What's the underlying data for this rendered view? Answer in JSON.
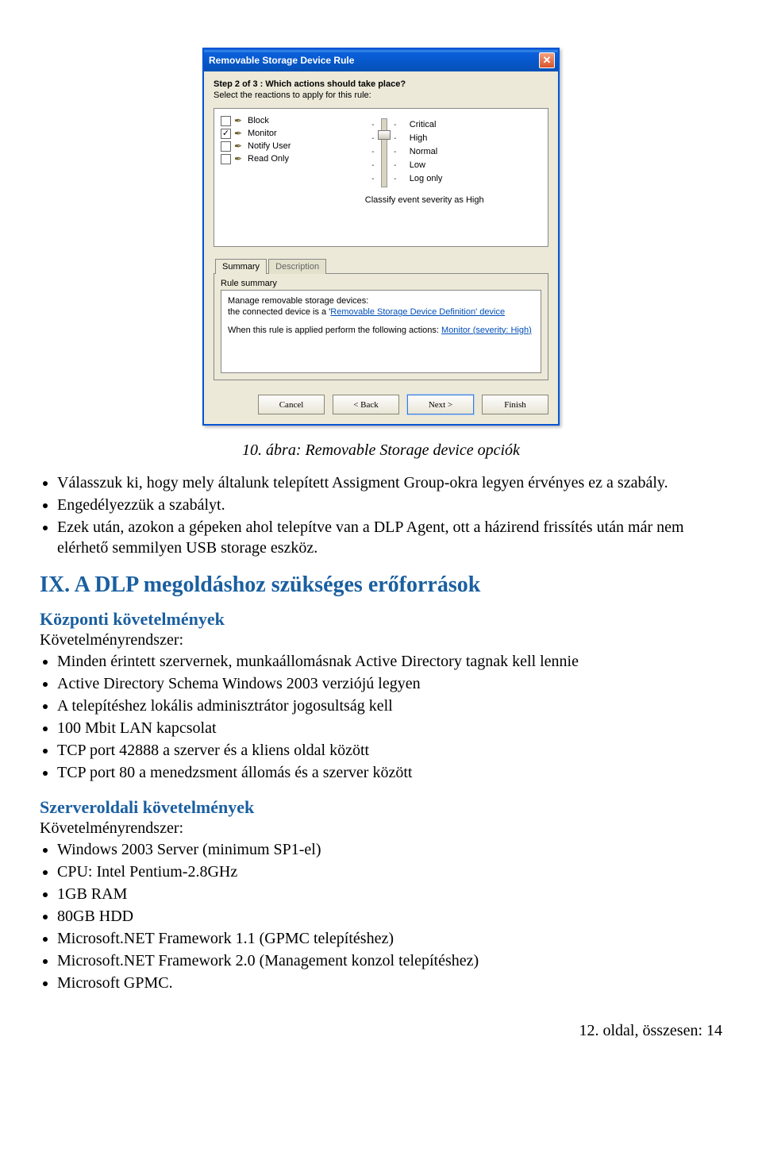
{
  "dialog": {
    "title": "Removable Storage Device Rule",
    "step_title": "Step 2 of 3 : Which actions should take place?",
    "step_sub": "Select the reactions to apply for this rule:",
    "actions": {
      "block": "Block",
      "monitor": "Monitor",
      "notify": "Notify User",
      "readonly": "Read Only"
    },
    "severities": {
      "critical": "Critical",
      "high": "High",
      "normal": "Normal",
      "low": "Low",
      "logonly": "Log only"
    },
    "classify_line": "Classify event severity as High",
    "tabs": {
      "summary": "Summary",
      "description": "Description"
    },
    "rule_summary_label": "Rule summary",
    "summary": {
      "line1": "Manage removable storage devices:",
      "line2_pre": "   the connected device is a '",
      "line2_link": "Removable Storage Device Definition' device",
      "line3_pre": "When this rule is applied perform the following actions: ",
      "line3_link": "Monitor (severity: High)"
    },
    "buttons": {
      "cancel": "Cancel",
      "back": "< Back",
      "next": "Next >",
      "finish": "Finish"
    }
  },
  "figure_caption": "10. ábra: Removable Storage device opciók",
  "bullets1": [
    "Válasszuk ki, hogy mely általunk telepített Assigment Group-okra legyen érvényes ez a szabály.",
    "Engedélyezzük a szabályt.",
    "Ezek után, azokon a gépeken ahol telepítve van a DLP Agent, ott a házirend frissítés után már nem elérhető semmilyen USB storage eszköz."
  ],
  "h2": "IX. A DLP megoldáshoz szükséges erőforrások",
  "sub1": "Központi követelmények",
  "req_label": "Követelményrendszer:",
  "bullets2": [
    "Minden érintett szervernek, munkaállomásnak Active Directory tagnak kell lennie",
    "Active Directory Schema Windows 2003 verziójú legyen",
    "A telepítéshez lokális adminisztrátor jogosultság kell",
    "100 Mbit LAN kapcsolat",
    "TCP port 42888 a szerver és a kliens oldal között",
    "TCP port 80 a menedzsment állomás és a szerver között"
  ],
  "sub2": "Szerveroldali követelmények",
  "bullets3": [
    "Windows 2003 Server (minimum SP1-el)",
    "CPU: Intel Pentium-2.8GHz",
    "1GB RAM",
    "80GB HDD",
    "Microsoft.NET Framework 1.1 (GPMC telepítéshez)",
    "Microsoft.NET Framework 2.0 (Management konzol telepítéshez)",
    "Microsoft GPMC."
  ],
  "footer": "12. oldal, összesen: 14"
}
